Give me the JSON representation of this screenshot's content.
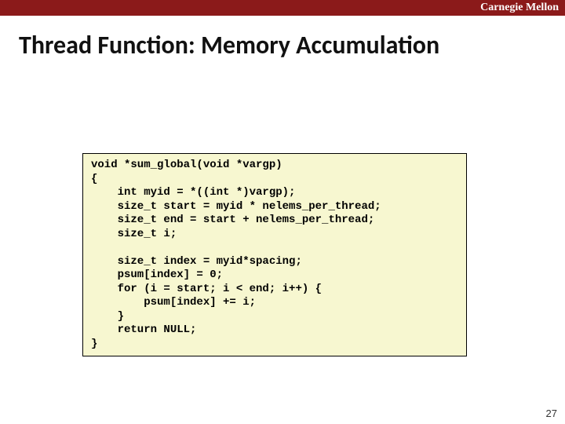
{
  "header": {
    "brand": "Carnegie Mellon"
  },
  "title": "Thread Function: Memory Accumulation",
  "code": "void *sum_global(void *vargp)\n{\n    int myid = *((int *)vargp);\n    size_t start = myid * nelems_per_thread;\n    size_t end = start + nelems_per_thread;\n    size_t i;\n\n    size_t index = myid*spacing;\n    psum[index] = 0;\n    for (i = start; i < end; i++) {\n        psum[index] += i;\n    }\n    return NULL;\n}",
  "page_number": "27"
}
